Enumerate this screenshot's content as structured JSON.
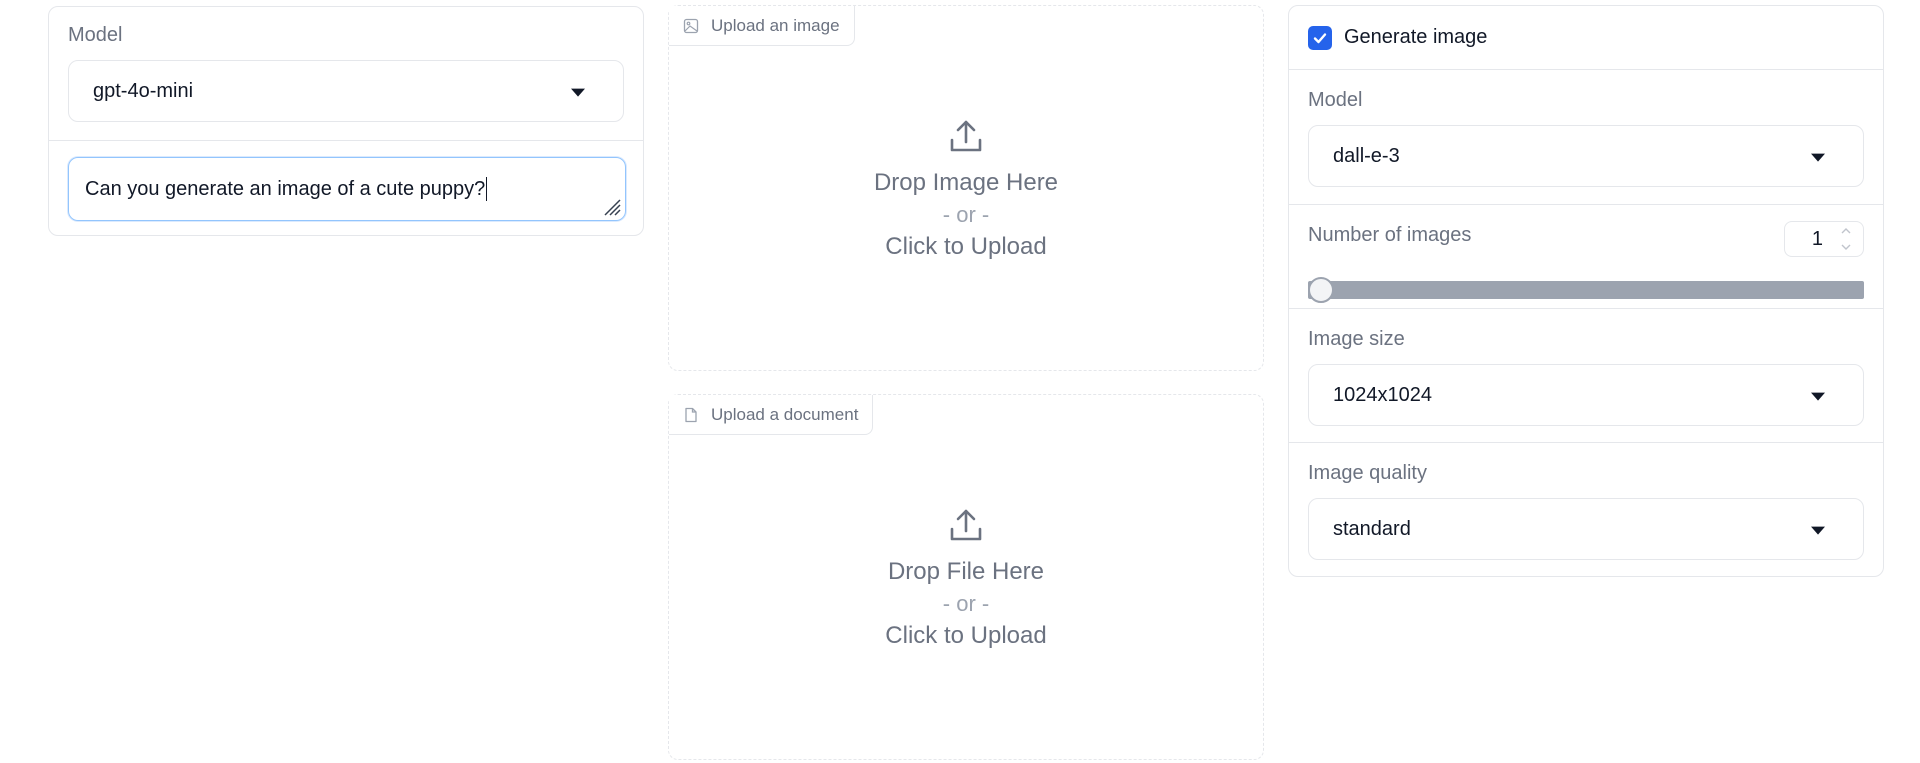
{
  "left": {
    "model_label": "Model",
    "model_value": "gpt-4o-mini",
    "prompt_text": "Can you generate an image of a cute puppy?"
  },
  "upload_image": {
    "tag": "Upload an image",
    "tag_icon": "image-icon",
    "drop_text": "Drop Image Here",
    "or_text": "- or -",
    "click_text": "Click to Upload",
    "icon": "upload-icon"
  },
  "upload_doc": {
    "tag": "Upload a document",
    "tag_icon": "file-icon",
    "drop_text": "Drop File Here",
    "or_text": "- or -",
    "click_text": "Click to Upload",
    "icon": "upload-icon"
  },
  "right": {
    "generate_label": "Generate image",
    "generate_checked": true,
    "model_label": "Model",
    "model_value": "dall-e-3",
    "num_images_label": "Number of images",
    "num_images_value": "1",
    "num_images_slider_fraction": 0,
    "image_size_label": "Image size",
    "image_size_value": "1024x1024",
    "image_quality_label": "Image quality",
    "image_quality_value": "standard"
  },
  "colors": {
    "accent": "#2563eb",
    "focus_border": "#93c5fd",
    "slider_track": "#9ca3af",
    "border": "#e5e7eb",
    "muted_text": "#6b7280"
  }
}
